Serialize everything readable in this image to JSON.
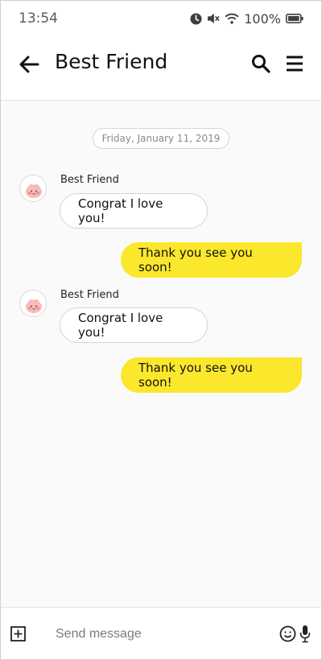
{
  "status_bar": {
    "time": "13:54",
    "battery": "100%",
    "icons": [
      "alarm-icon",
      "mute-icon",
      "wifi-icon",
      "battery-icon"
    ]
  },
  "header": {
    "title": "Best Friend",
    "icons": [
      "back-arrow-icon",
      "search-icon",
      "menu-icon"
    ]
  },
  "chat": {
    "date": "Friday, January 11, 2019",
    "messages": [
      {
        "direction": "in",
        "sender": "Best Friend",
        "text": "Congrat I love you!"
      },
      {
        "direction": "out",
        "text": "Thank you see you soon!"
      },
      {
        "direction": "in",
        "sender": "Best Friend",
        "text": "Congrat I love you!"
      },
      {
        "direction": "out",
        "text": "Thank you see you soon!"
      }
    ]
  },
  "input_bar": {
    "placeholder": "Send message",
    "icons": [
      "plus-box-icon",
      "emoji-icon",
      "microphone-icon"
    ]
  },
  "colors": {
    "outgoing_bubble": "#fbe72c",
    "incoming_bubble": "#ffffff",
    "chat_background": "#fafafa"
  }
}
